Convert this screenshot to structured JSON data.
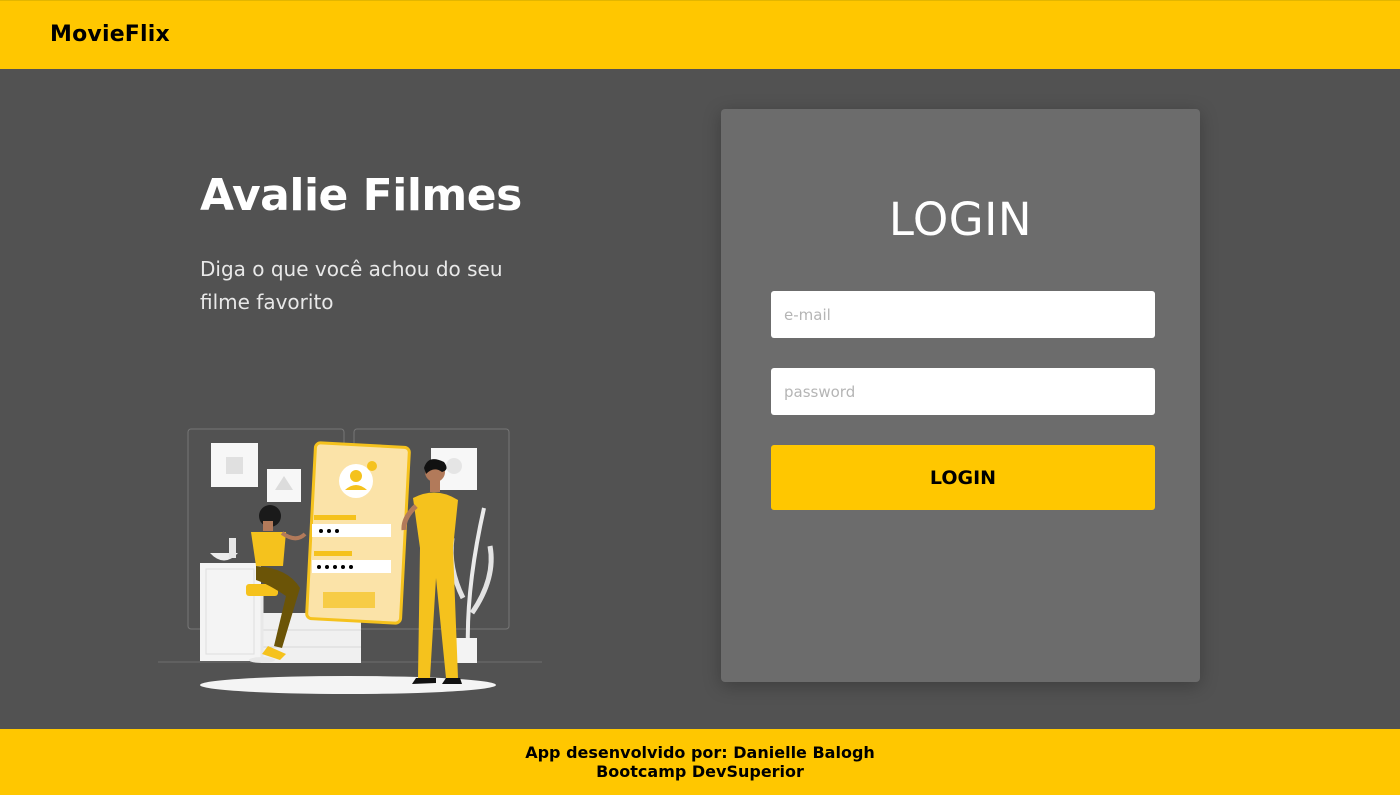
{
  "navbar": {
    "brand": "MovieFlix"
  },
  "hero": {
    "title": "Avalie Filmes",
    "subtitle": "Diga o que você achou do seu filme favorito"
  },
  "login": {
    "title": "LOGIN",
    "email_placeholder": "e-mail",
    "password_placeholder": "password",
    "button_label": "LOGIN"
  },
  "footer": {
    "line1": "App desenvolvido por:  Danielle Balogh",
    "line2": "Bootcamp DevSuperior"
  },
  "colors": {
    "accent": "#ffc700",
    "background": "#525252",
    "card": "#6c6c6c"
  }
}
